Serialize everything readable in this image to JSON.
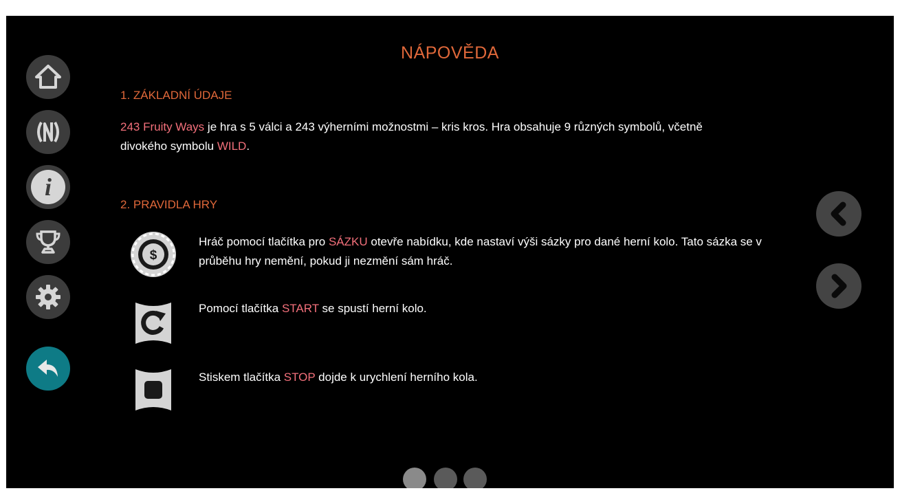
{
  "page": {
    "title": "NÁPOVĚDA"
  },
  "sections": [
    {
      "heading": "1. ZÁKLADNÍ ÚDAJE",
      "text": {
        "game_name": "243 Fruity Ways",
        "part1": " je hra s 5 válci a 243 výherními možnostmi – kris kros. Hra obsahuje 9 různých symbolů, včetně divokého symbolu ",
        "wild": "WILD",
        "part2": "."
      }
    },
    {
      "heading": "2. PRAVIDLA HRY",
      "rules": [
        {
          "icon": "coin-icon",
          "before": "Hráč pomocí tlačítka pro ",
          "keyword": "SÁZKU",
          "after": " otevře nabídku, kde nastaví výši sázky pro dané herní kolo. Tato sázka se v průběhu hry nemění, pokud ji nezmění sám hráč."
        },
        {
          "icon": "start-spin-icon",
          "before": "Pomocí tlačítka ",
          "keyword": "START",
          "after": " se spustí herní kolo."
        },
        {
          "icon": "stop-square-icon",
          "before": "Stiskem tlačítka ",
          "keyword": "STOP",
          "after": " dojde k urychlení herního kola."
        }
      ]
    }
  ],
  "sidebar": {
    "buttons": [
      "home-icon",
      "paytable-icon",
      "info-icon",
      "trophy-icon",
      "settings-gear-icon",
      "back-arrow-icon"
    ]
  },
  "pagination": {
    "pages": 3,
    "current": 1
  },
  "colors": {
    "background": "#000000",
    "heading": "#e0683a",
    "highlight": "#f3707b",
    "text": "#ffffff",
    "button": "#3c3c3c",
    "back_button": "#0e7b86"
  }
}
